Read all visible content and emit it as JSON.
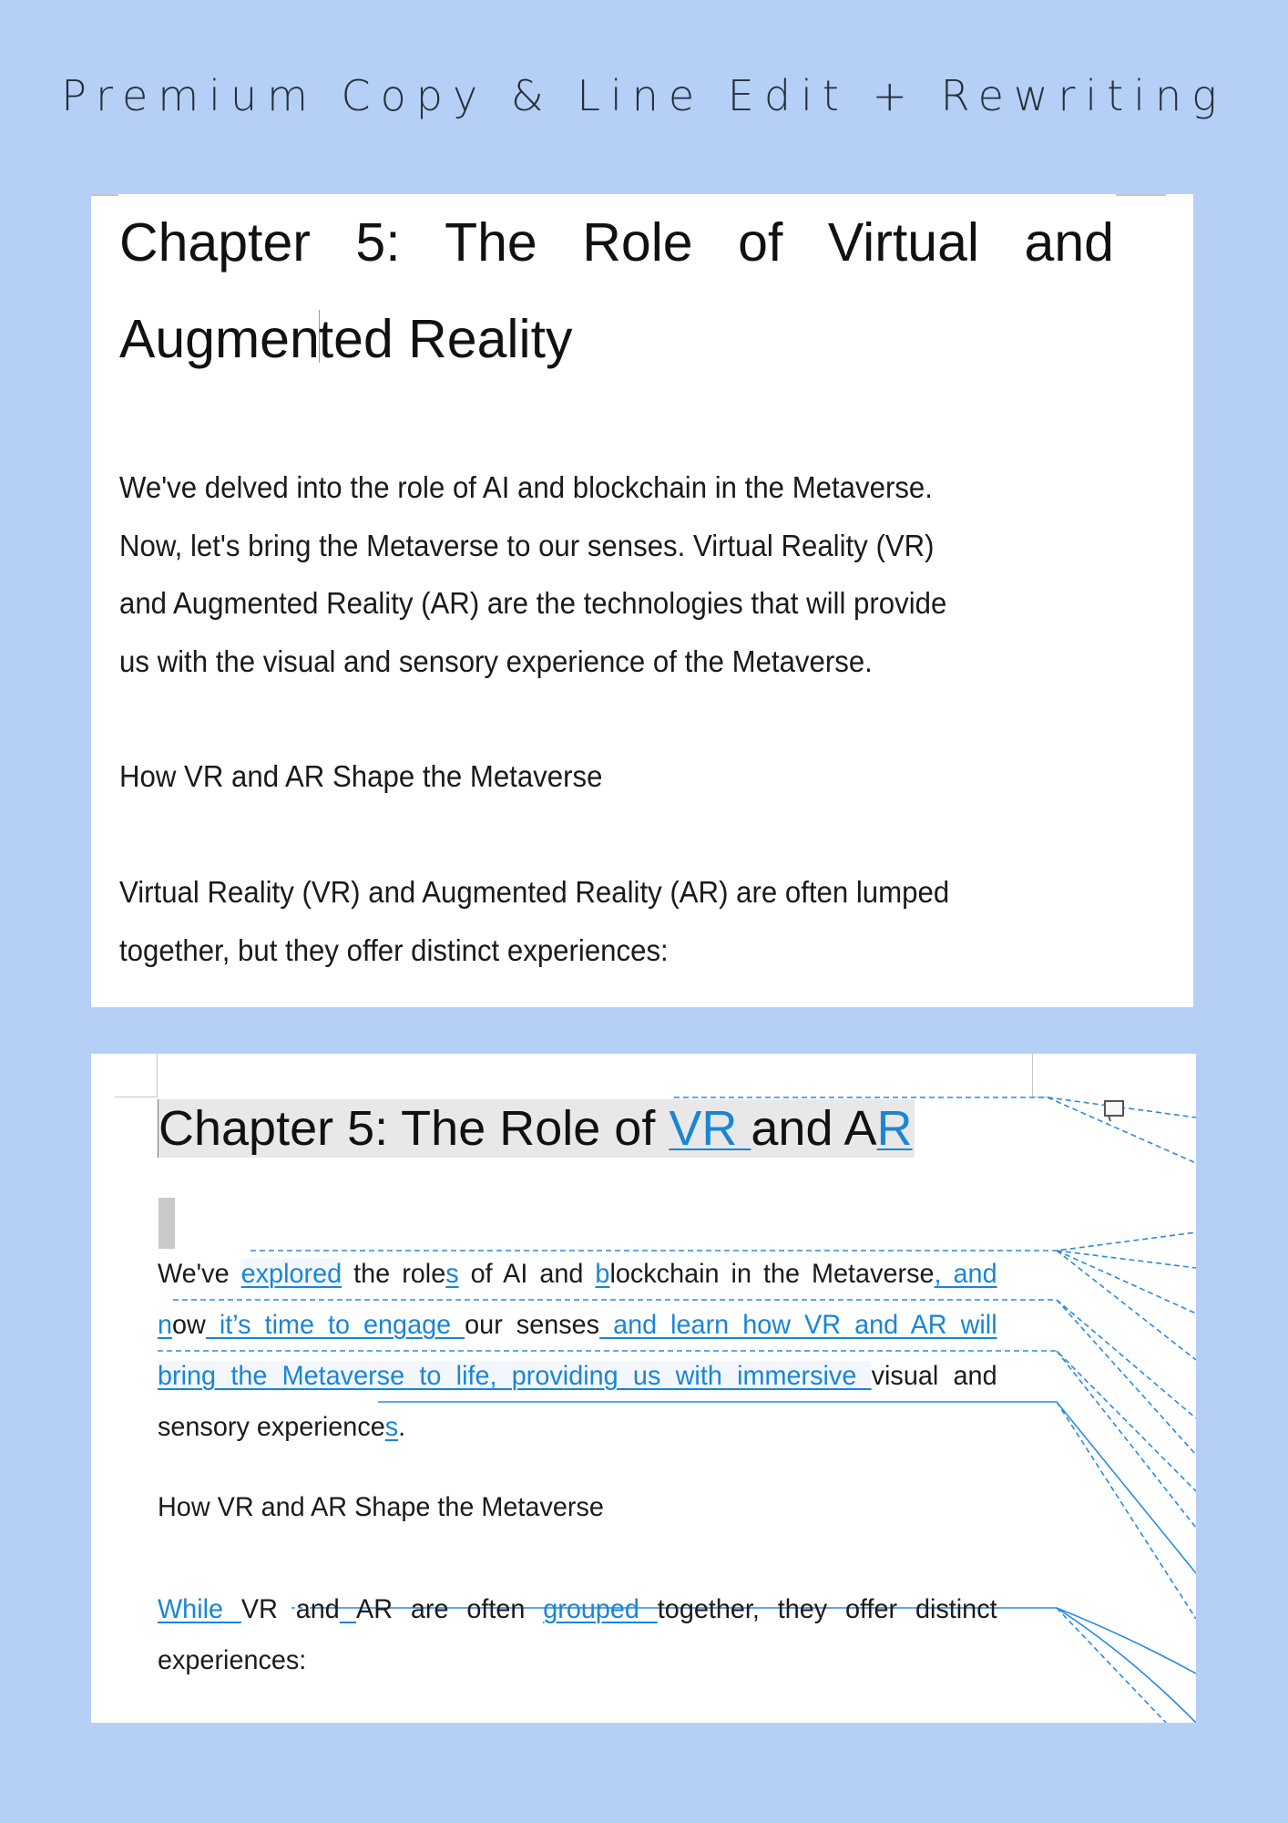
{
  "banner": {
    "title": "Premium Copy & Line Edit + Rewriting"
  },
  "colors": {
    "background": "#b6cff7",
    "insertion": "#1a85d6",
    "text": "#1b1b1b"
  },
  "before": {
    "heading_line1": "Chapter 5: The Role of Virtual and",
    "heading_line2_a": "Augmen",
    "heading_line2_b": "ted Reality",
    "paragraph1": [
      "We've delved into the role of AI and blockchain in the Metaverse.",
      "Now, let's bring the Metaverse to our senses. Virtual Reality (VR)",
      "and Augmented Reality (AR) are the technologies that will provide",
      "us with the visual and sensory experience of the Metaverse."
    ],
    "subheading": "How VR and AR Shape the Metaverse",
    "paragraph2": [
      "Virtual Reality (VR) and Augmented Reality (AR) are often lumped",
      "together, but they offer distinct experiences:"
    ]
  },
  "after": {
    "heading": {
      "t1": "Chapter 5: The Role of ",
      "ins1": "VR ",
      "t2": "and A",
      "ins2": "R"
    },
    "p1": {
      "l1": {
        "t1": "We've ",
        "i1": "explored",
        "t2": " the role",
        "i2": "s",
        "t3": " of AI and ",
        "i3": "b",
        "t4": "lockchain in the Metaverse",
        "i4": ", and"
      },
      "l2": {
        "i1": "n",
        "t1": "ow",
        "i2": " it’s time to engage ",
        "t2": "our senses",
        "i3": " and learn how VR and AR will"
      },
      "l3": {
        "i1": "bring the Metaverse to life, providing us with immersive ",
        "t1": "visual and"
      },
      "l4": {
        "t1": "sensory experience",
        "i1": "s",
        "t2": "."
      }
    },
    "subheading": "How VR and AR Shape the Metaverse",
    "p2": {
      "l1": {
        "i1": "While ",
        "t1": "VR and",
        "i2": " ",
        "t2": "AR are often ",
        "i3": "grouped ",
        "t3": "together, they offer distinct"
      },
      "l2": {
        "t1": "experiences:"
      }
    },
    "comment_icon": "comment-icon"
  }
}
